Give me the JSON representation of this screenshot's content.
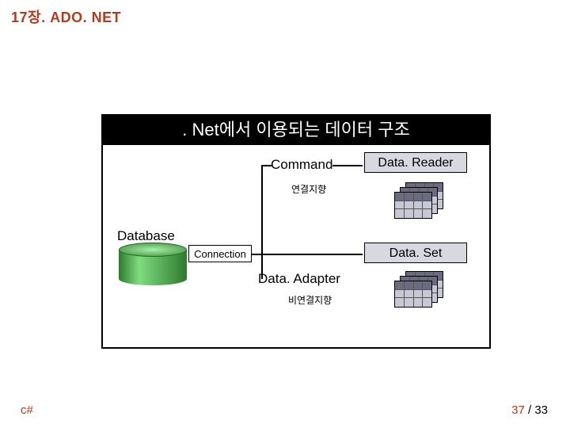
{
  "header": {
    "chapter": "17장. ADO. NET"
  },
  "diagram": {
    "title": ". Net에서 이용되는 데이터 구조",
    "database_label": "Database",
    "connection_label": "Connection",
    "command_label": "Command",
    "datareader_label": "Data. Reader",
    "connected_oriented": "연결지향",
    "dataset_label": "Data. Set",
    "dataadapter_label": "Data. Adapter",
    "disconnected_oriented": "비연결지향"
  },
  "footer": {
    "lang": "c#",
    "page_current": "37",
    "page_sep": " / ",
    "page_total": "33"
  }
}
